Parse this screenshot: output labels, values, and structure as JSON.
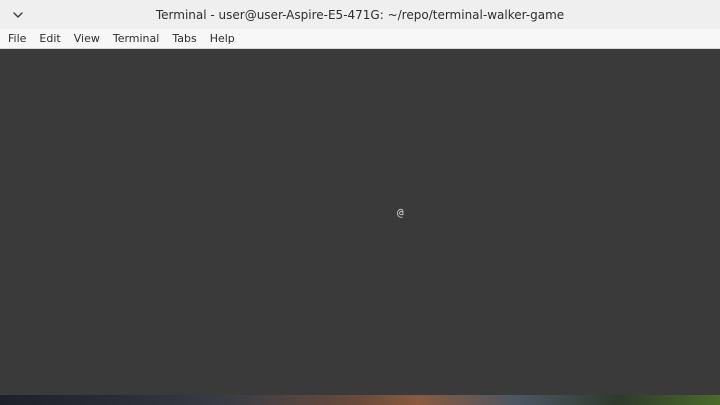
{
  "window": {
    "title": "Terminal - user@user-Aspire-E5-471G: ~/repo/terminal-walker-game"
  },
  "menubar": {
    "items": [
      {
        "label": "File"
      },
      {
        "label": "Edit"
      },
      {
        "label": "View"
      },
      {
        "label": "Terminal"
      },
      {
        "label": "Tabs"
      },
      {
        "label": "Help"
      }
    ]
  },
  "terminal": {
    "player_glyph": "@"
  },
  "icons": {
    "window_menu": "chevron-down-icon"
  },
  "colors": {
    "titlebar_bg": "#efefef",
    "menubar_bg": "#f7f7f7",
    "terminal_bg": "#3a3a3a",
    "terminal_fg": "#dcdcdc"
  }
}
